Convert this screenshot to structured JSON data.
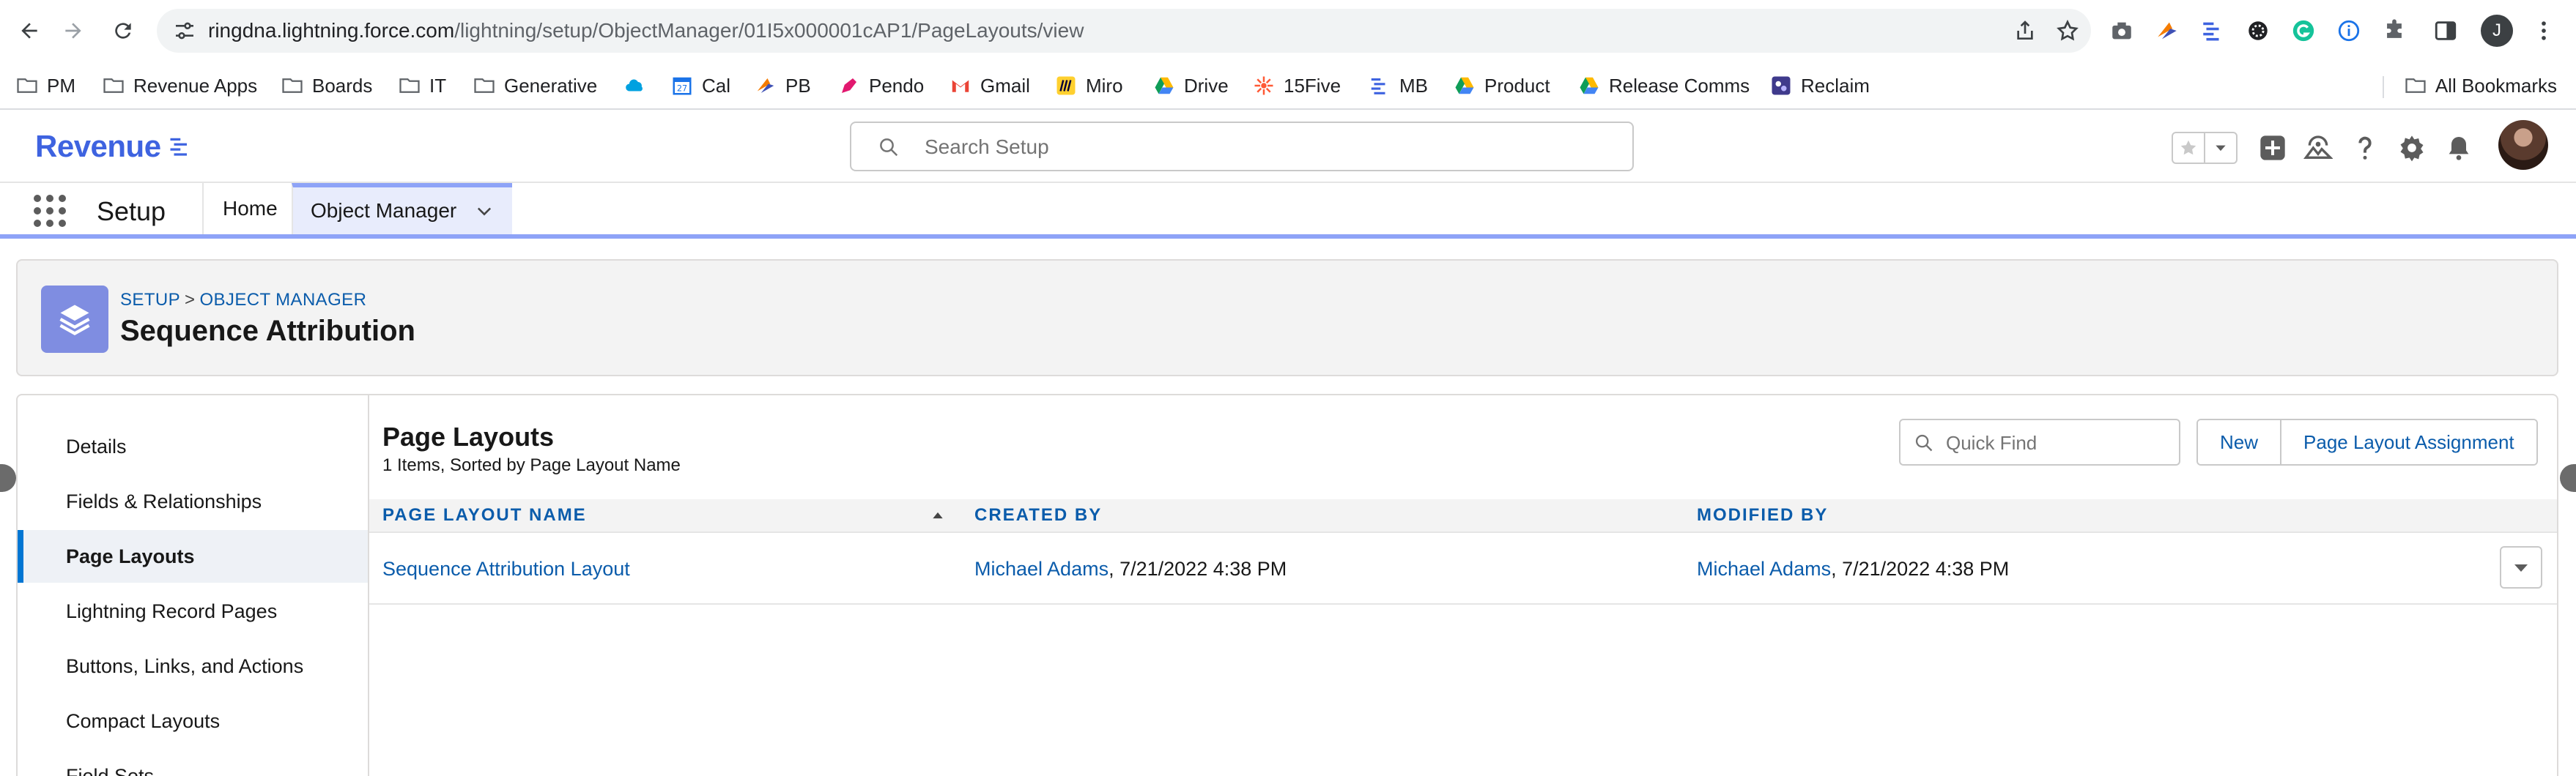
{
  "browser": {
    "url_host": "ringdna.lightning.force.com",
    "url_path": "/lightning/setup/ObjectManager/01I5x000001cAP1/PageLayouts/view",
    "profile_initial": "J",
    "bookmarks": [
      "PM",
      "Revenue Apps",
      "Boards",
      "IT",
      "Generative",
      "",
      "Cal",
      "PB",
      "Pendo",
      "Gmail",
      "Miro",
      "Drive",
      "15Five",
      "MB",
      "Product",
      "Release Comms",
      "Reclaim"
    ],
    "all_bookmarks": "All Bookmarks"
  },
  "header": {
    "brand": "Revenue",
    "search_placeholder": "Search Setup"
  },
  "nav": {
    "app_name": "Setup",
    "tabs": [
      "Home",
      "Object Manager"
    ]
  },
  "page_header": {
    "breadcrumb_setup": "SETUP",
    "breadcrumb_sep": ">",
    "breadcrumb_object_manager": "OBJECT MANAGER",
    "title": "Sequence Attribution"
  },
  "sidebar": {
    "items": [
      "Details",
      "Fields & Relationships",
      "Page Layouts",
      "Lightning Record Pages",
      "Buttons, Links, and Actions",
      "Compact Layouts",
      "Field Sets"
    ],
    "active": "Page Layouts"
  },
  "list": {
    "title": "Page Layouts",
    "subtitle": "1 Items, Sorted by Page Layout Name",
    "quick_find_placeholder": "Quick Find",
    "new_label": "New",
    "assignment_label": "Page Layout Assignment",
    "columns": [
      "PAGE LAYOUT NAME",
      "CREATED BY",
      "MODIFIED BY"
    ],
    "rows": [
      {
        "name": "Sequence Attribution Layout",
        "created_by": "Michael Adams",
        "created_date": ", 7/21/2022 4:38 PM",
        "modified_by": "Michael Adams",
        "modified_date": ", 7/21/2022 4:38 PM"
      }
    ]
  },
  "colors": {
    "brand": "#3e63e0",
    "link": "#0b5cab",
    "accent": "#8ea3f7",
    "object_icon": "#7f8de1"
  }
}
